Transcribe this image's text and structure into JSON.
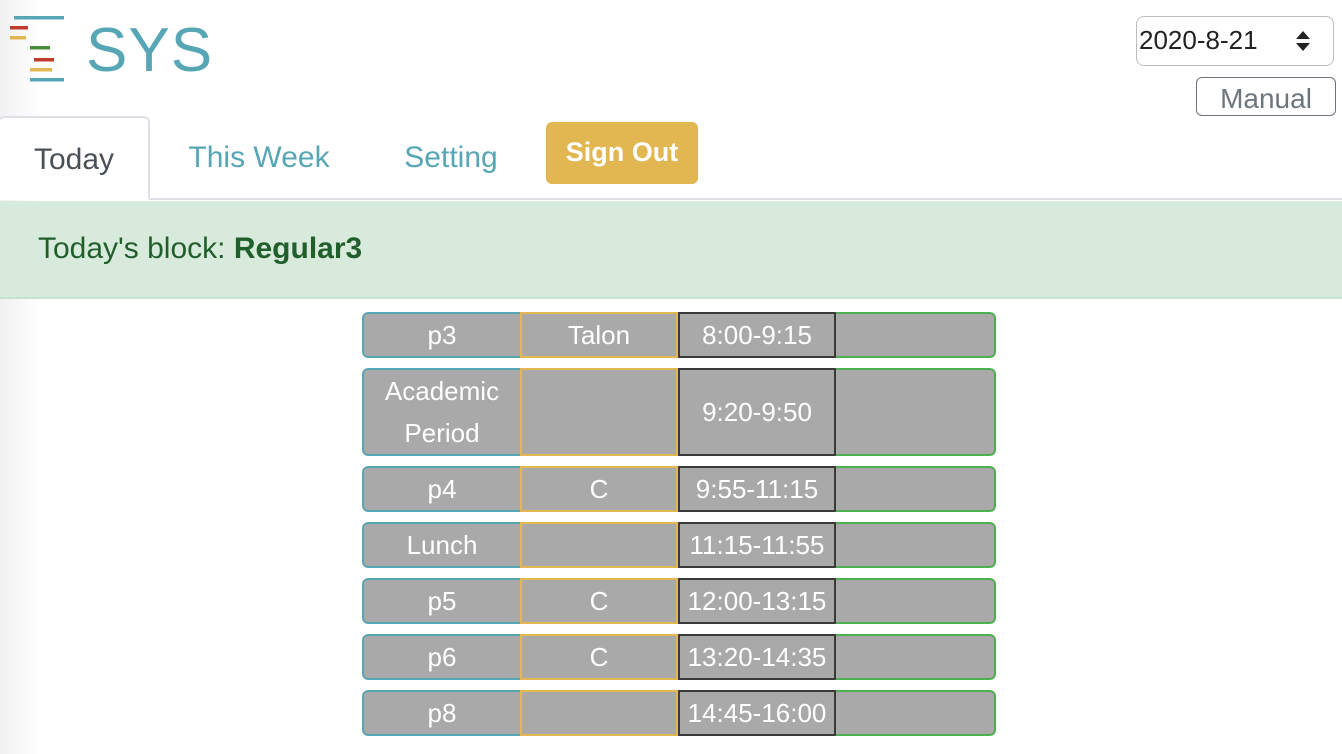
{
  "header": {
    "app_title": "SYS",
    "logo_icon": "list-bars-icon"
  },
  "date_selector": {
    "value": "2020-8-21",
    "icon": "sort-arrows-icon"
  },
  "manual_button": {
    "label": "Manual"
  },
  "tabs": [
    {
      "label": "Today",
      "active": true
    },
    {
      "label": "This Week",
      "active": false
    },
    {
      "label": "Setting",
      "active": false
    }
  ],
  "signout_button": {
    "label": "Sign Out"
  },
  "block_info": {
    "prefix": "Today's block: ",
    "name": "Regular3"
  },
  "schedule": [
    {
      "period": "p3",
      "class": "Talon",
      "time": "8:00-9:15",
      "extra": ""
    },
    {
      "period": "Academic Period",
      "class": "",
      "time": "9:20-9:50",
      "extra": ""
    },
    {
      "period": "p4",
      "class": "C",
      "time": "9:55-11:15",
      "extra": ""
    },
    {
      "period": "Lunch",
      "class": "",
      "time": "11:15-11:55",
      "extra": ""
    },
    {
      "period": "p5",
      "class": "C",
      "time": "12:00-13:15",
      "extra": ""
    },
    {
      "period": "p6",
      "class": "C",
      "time": "13:20-14:35",
      "extra": ""
    },
    {
      "period": "p8",
      "class": "",
      "time": "14:45-16:00",
      "extra": ""
    }
  ],
  "colors": {
    "brand": "#56a6b6",
    "signout": "#e2b752",
    "alert_bg": "#d8eadc",
    "alert_text": "#205f2b",
    "cell_bg": "#a9a9a9"
  }
}
